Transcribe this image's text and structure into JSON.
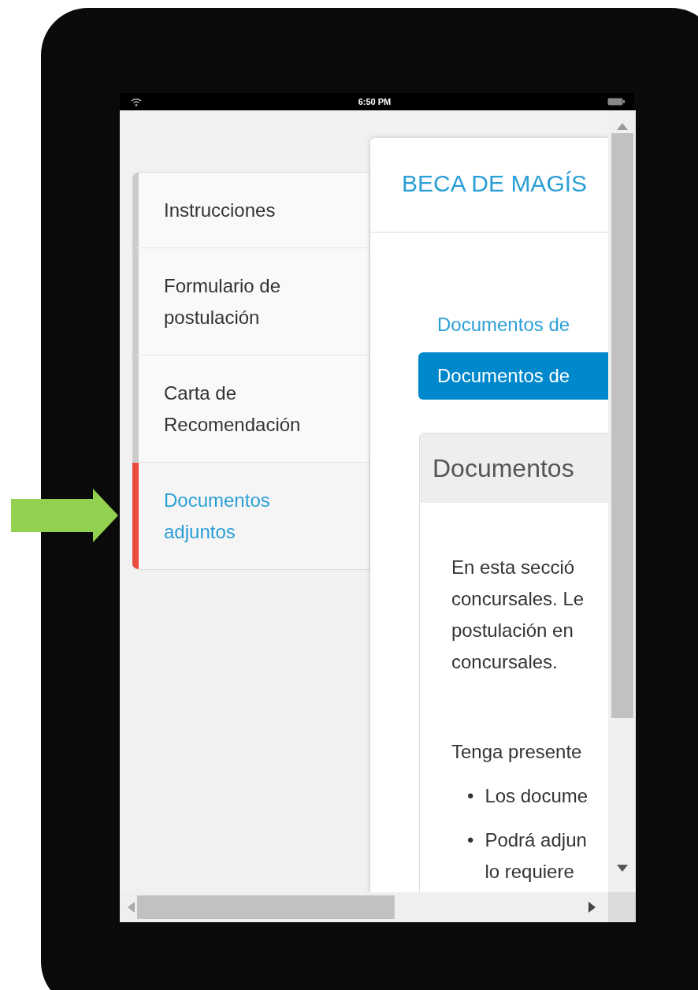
{
  "status_bar": {
    "time": "6:50 PM"
  },
  "sidebar": {
    "items": [
      {
        "label": "Instrucciones",
        "selected": false
      },
      {
        "label": "Formulario de postulación",
        "selected": false
      },
      {
        "label": "Carta de Recomendación",
        "selected": false
      },
      {
        "label": "Documentos adjuntos",
        "selected": true
      }
    ]
  },
  "main": {
    "title": "BECA DE MAGÍS",
    "link": "Documentos de",
    "button": "Documentos de",
    "card": {
      "title": "Documentos",
      "paragraph": [
        "En esta secció",
        "concursales. Le",
        "postulación en",
        "concursales."
      ],
      "note": "Tenga presente",
      "bullets": [
        {
          "marker": "•",
          "lines": [
            "Los docume"
          ]
        },
        {
          "marker": "•",
          "lines": [
            "Podrá adjun",
            "lo requiere"
          ]
        }
      ]
    }
  }
}
